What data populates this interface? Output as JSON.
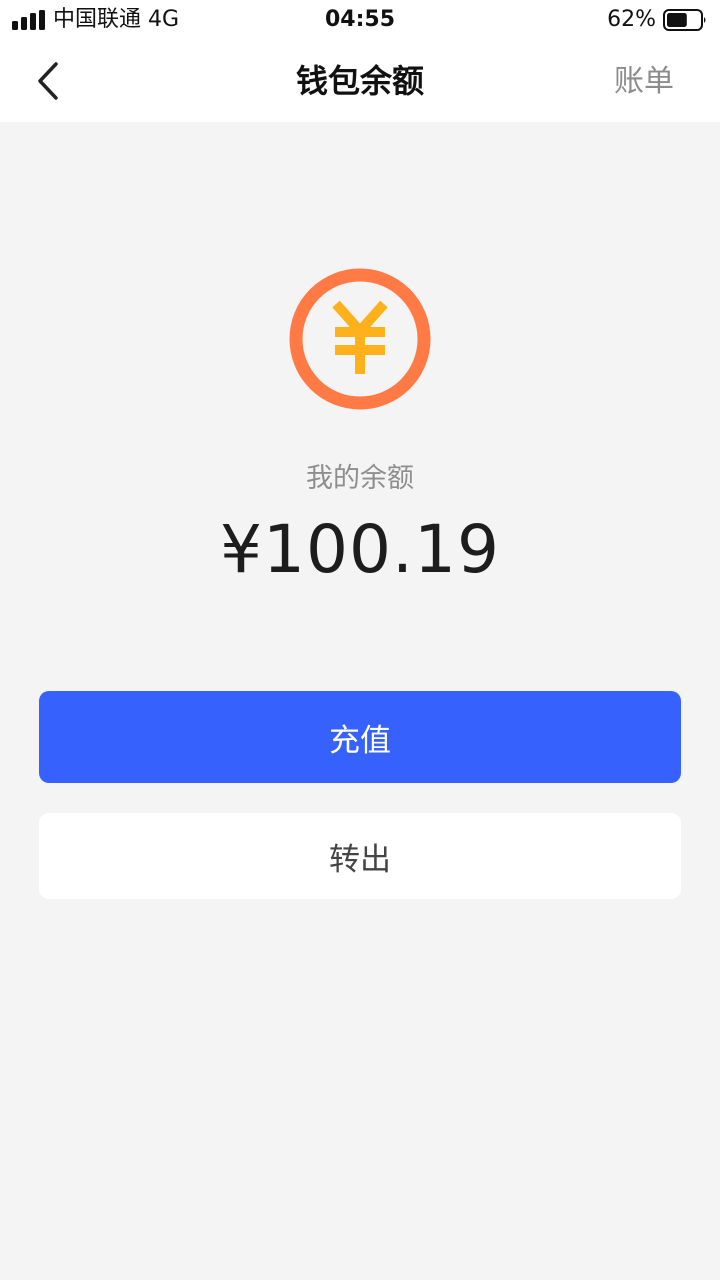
{
  "status_bar": {
    "carrier": "中国联通  4G",
    "time": "04:55",
    "battery_percent": "62%",
    "battery_level": 0.62,
    "signal_bars": 4,
    "icons": [
      "signal-icon",
      "battery-icon"
    ]
  },
  "nav": {
    "title": "钱包余额",
    "right_action": "账单",
    "back_icon": "chevron-left-icon"
  },
  "wallet": {
    "coin_icon": "yuan-coin-icon",
    "balance_label": "我的余额",
    "balance_amount": "¥100.19"
  },
  "actions": {
    "recharge_label": "充值",
    "transfer_label": "转出"
  },
  "colors": {
    "primary_button": "#3761fc",
    "coin_ring": "#ff7a45",
    "coin_symbol": "#ffb11b",
    "page_background": "#f4f4f4"
  }
}
